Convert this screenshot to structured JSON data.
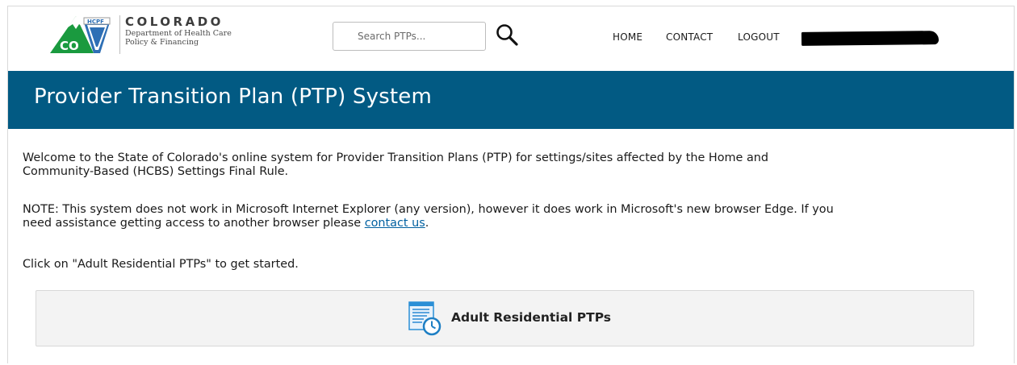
{
  "header": {
    "logo": {
      "badge_text": "HCPF",
      "state_letters": "CO",
      "title": "COLORADO",
      "subtitle_line1": "Department of Health Care",
      "subtitle_line2": "Policy & Financing",
      "green": "#1a9a3f",
      "blue": "#2e6fb5"
    },
    "search": {
      "placeholder": "Search PTPs...",
      "value": "",
      "icon": "magnifier-icon"
    },
    "nav": [
      "HOME",
      "CONTACT",
      "LOGOUT"
    ],
    "user_name_redacted": true
  },
  "banner": {
    "title": "Provider Transition Plan (PTP) System",
    "color": "#025a83"
  },
  "main": {
    "intro_line1": "Welcome to the State of Colorado's online system for Provider Transition Plans (PTP) for settings/sites affected by the Home and",
    "intro_line2": "Community-Based (HCBS) Settings Final Rule.",
    "note_line1": "NOTE: This system does not work in Microsoft Internet Explorer (any version), however it does work in Microsoft's new browser Edge. If you",
    "note_line2_prefix": "need assistance getting access to another browser please ",
    "note_link": "contact us",
    "note_line2_suffix": ".",
    "instruction": "Click on \"Adult Residential PTPs\" to get started.",
    "card": {
      "label": "Adult Residential PTPs",
      "icon": "document-clock-icon",
      "accent": "#2b8fd6"
    }
  }
}
